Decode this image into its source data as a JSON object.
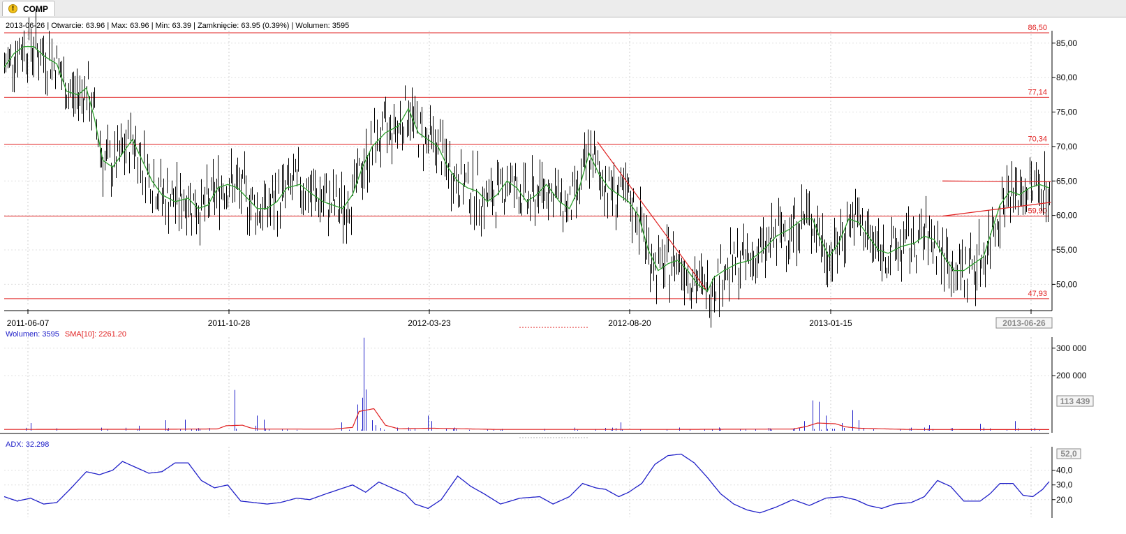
{
  "tab": {
    "label": "COMP",
    "icon": "warning-icon"
  },
  "info_bar": "2013-06-26 | Otwarcie: 63.96 | Max: 63.96 | Min: 63.39 | Zamknięcie: 63.95 (0.39%) | Wolumen: 3595",
  "colors": {
    "price_bars": "#000000",
    "ma_line": "#2ca02c",
    "levels": "#e02020",
    "volume_bars": "#2020c8",
    "sma": "#e02020",
    "adx": "#2020c8"
  },
  "chart_data": [
    {
      "type": "bar",
      "name": "price",
      "ylim": [
        47.0,
        86.8
      ],
      "yticks": [
        "85,00",
        "80,00",
        "75,00",
        "70,00",
        "65,00",
        "60,00",
        "55,00",
        "50,00"
      ],
      "ytick_values": [
        85,
        80,
        75,
        70,
        65,
        60,
        55,
        50
      ],
      "date_labels": [
        "2011-06-07",
        "2011-10-28",
        "2012-03-23",
        "2012-08-20",
        "2013-01-15"
      ],
      "last_date": "2013-06-26",
      "levels": [
        {
          "value": 86.5,
          "label": "86,50"
        },
        {
          "value": 77.14,
          "label": "77,14"
        },
        {
          "value": 70.34,
          "label": "70,34"
        },
        {
          "value": 59.9,
          "label": "59,90"
        },
        {
          "value": 47.93,
          "label": "47,93"
        }
      ],
      "ma_anchors": [
        [
          0,
          81.5
        ],
        [
          6,
          83.5
        ],
        [
          12,
          84.5
        ],
        [
          18,
          84.5
        ],
        [
          25,
          83
        ],
        [
          32,
          82
        ],
        [
          38,
          78
        ],
        [
          45,
          77.5
        ],
        [
          50,
          78.5
        ],
        [
          55,
          74
        ],
        [
          60,
          68
        ],
        [
          66,
          67
        ],
        [
          72,
          69
        ],
        [
          78,
          71
        ],
        [
          84,
          68
        ],
        [
          90,
          65
        ],
        [
          96,
          63
        ],
        [
          104,
          62
        ],
        [
          112,
          62.5
        ],
        [
          118,
          61
        ],
        [
          124,
          61.5
        ],
        [
          130,
          64
        ],
        [
          136,
          64.5
        ],
        [
          142,
          64
        ],
        [
          148,
          62.5
        ],
        [
          154,
          61
        ],
        [
          160,
          61
        ],
        [
          166,
          62
        ],
        [
          172,
          64
        ],
        [
          180,
          64.5
        ],
        [
          188,
          63
        ],
        [
          194,
          62
        ],
        [
          200,
          61.5
        ],
        [
          206,
          61
        ],
        [
          212,
          63
        ],
        [
          218,
          67
        ],
        [
          224,
          70
        ],
        [
          232,
          72
        ],
        [
          240,
          73
        ],
        [
          246,
          75.5
        ],
        [
          252,
          72
        ],
        [
          258,
          71
        ],
        [
          264,
          70
        ],
        [
          270,
          67
        ],
        [
          276,
          65
        ],
        [
          282,
          64
        ],
        [
          288,
          63.5
        ],
        [
          294,
          62
        ],
        [
          300,
          63
        ],
        [
          306,
          65
        ],
        [
          312,
          64
        ],
        [
          318,
          62
        ],
        [
          324,
          63
        ],
        [
          330,
          64.5
        ],
        [
          338,
          62
        ],
        [
          344,
          61
        ],
        [
          350,
          64
        ],
        [
          356,
          69
        ],
        [
          362,
          66
        ],
        [
          368,
          64
        ],
        [
          374,
          63
        ],
        [
          380,
          62
        ],
        [
          386,
          60
        ],
        [
          392,
          55
        ],
        [
          398,
          52
        ],
        [
          404,
          53
        ],
        [
          410,
          53.5
        ],
        [
          416,
          52
        ],
        [
          422,
          50
        ],
        [
          428,
          49
        ],
        [
          432,
          51
        ],
        [
          438,
          52
        ],
        [
          446,
          53
        ],
        [
          454,
          53.5
        ],
        [
          462,
          55
        ],
        [
          470,
          57
        ],
        [
          478,
          58
        ],
        [
          486,
          59.5
        ],
        [
          492,
          59.5
        ],
        [
          496,
          57
        ],
        [
          502,
          54
        ],
        [
          508,
          56
        ],
        [
          514,
          59.5
        ],
        [
          520,
          59
        ],
        [
          526,
          57
        ],
        [
          532,
          55
        ],
        [
          538,
          54.5
        ],
        [
          546,
          55.5
        ],
        [
          554,
          56
        ],
        [
          560,
          57
        ],
        [
          566,
          56.5
        ],
        [
          572,
          54
        ],
        [
          578,
          52
        ],
        [
          584,
          52
        ],
        [
          590,
          53
        ],
        [
          596,
          54
        ],
        [
          600,
          57
        ],
        [
          606,
          61.5
        ],
        [
          612,
          63.5
        ],
        [
          618,
          63
        ],
        [
          624,
          64
        ],
        [
          630,
          64.5
        ],
        [
          636,
          64
        ]
      ],
      "trend_lines": [
        {
          "from": [
            "2012-08-07",
            70.7
          ],
          "to": [
            "2012-12-06",
            49.3
          ]
        },
        {
          "from": [
            "2013-05-21",
            65.0
          ],
          "to": [
            "2013-06-26",
            64.9
          ]
        },
        {
          "from": [
            "2013-05-21",
            59.9
          ],
          "to": [
            "2013-06-26",
            61.9
          ]
        }
      ]
    },
    {
      "type": "bar",
      "name": "Wolumen",
      "legend_value": "Wolumen: 3595",
      "sma_legend": "SMA[10]: 2261.20",
      "yticks": [
        "300 000",
        "200 000"
      ],
      "ytick_values": [
        300000,
        200000
      ],
      "last_label": "113 439",
      "ylim": [
        0,
        340000
      ],
      "spikes": [
        [
          16,
          28000
        ],
        [
          82,
          18000
        ],
        [
          98,
          38000
        ],
        [
          110,
          40000
        ],
        [
          140,
          148000
        ],
        [
          153,
          18000
        ],
        [
          154,
          55000
        ],
        [
          158,
          40000
        ],
        [
          205,
          30000
        ],
        [
          215,
          95000
        ],
        [
          218,
          120000
        ],
        [
          219,
          338000
        ],
        [
          220,
          150000
        ],
        [
          224,
          38000
        ],
        [
          226,
          20000
        ],
        [
          258,
          55000
        ],
        [
          260,
          35000
        ],
        [
          375,
          30000
        ],
        [
          487,
          35000
        ],
        [
          492,
          110000
        ],
        [
          496,
          105000
        ],
        [
          500,
          55000
        ],
        [
          510,
          28000
        ],
        [
          516,
          75000
        ],
        [
          520,
          38000
        ],
        [
          563,
          20000
        ],
        [
          594,
          25000
        ],
        [
          615,
          35000
        ]
      ],
      "base_volume": 3000,
      "sma_anchors": [
        [
          0,
          4500
        ],
        [
          50,
          5000
        ],
        [
          100,
          5200
        ],
        [
          130,
          6500
        ],
        [
          135,
          18000
        ],
        [
          145,
          20000
        ],
        [
          150,
          10000
        ],
        [
          155,
          6000
        ],
        [
          200,
          5500
        ],
        [
          212,
          12000
        ],
        [
          216,
          70000
        ],
        [
          225,
          80000
        ],
        [
          232,
          20000
        ],
        [
          240,
          7000
        ],
        [
          260,
          9000
        ],
        [
          300,
          4500
        ],
        [
          400,
          4500
        ],
        [
          480,
          6000
        ],
        [
          488,
          15000
        ],
        [
          495,
          28000
        ],
        [
          506,
          25000
        ],
        [
          512,
          14000
        ],
        [
          520,
          9000
        ],
        [
          550,
          4500
        ],
        [
          600,
          4000
        ],
        [
          636,
          4000
        ]
      ]
    },
    {
      "type": "line",
      "name": "ADX",
      "legend_value": "ADX: 32.298",
      "yticks": [
        "40,0",
        "30,0",
        "20,0"
      ],
      "ytick_values": [
        40,
        30,
        20
      ],
      "last_label": "52,0",
      "ylim": [
        8,
        56
      ],
      "anchors": [
        [
          0,
          22
        ],
        [
          8,
          19
        ],
        [
          16,
          21
        ],
        [
          24,
          17
        ],
        [
          32,
          18
        ],
        [
          40,
          27
        ],
        [
          50,
          39
        ],
        [
          58,
          37
        ],
        [
          66,
          40
        ],
        [
          72,
          46
        ],
        [
          80,
          42
        ],
        [
          88,
          38
        ],
        [
          96,
          39
        ],
        [
          104,
          45
        ],
        [
          112,
          45
        ],
        [
          120,
          33
        ],
        [
          128,
          28
        ],
        [
          136,
          30
        ],
        [
          144,
          19
        ],
        [
          152,
          18
        ],
        [
          160,
          17
        ],
        [
          168,
          18
        ],
        [
          178,
          21
        ],
        [
          186,
          20
        ],
        [
          196,
          24
        ],
        [
          204,
          27
        ],
        [
          212,
          30
        ],
        [
          220,
          25
        ],
        [
          228,
          32
        ],
        [
          236,
          28
        ],
        [
          244,
          24
        ],
        [
          250,
          17
        ],
        [
          258,
          14
        ],
        [
          266,
          20
        ],
        [
          276,
          36
        ],
        [
          284,
          29
        ],
        [
          292,
          24
        ],
        [
          302,
          17
        ],
        [
          314,
          21
        ],
        [
          326,
          22
        ],
        [
          334,
          17
        ],
        [
          344,
          22
        ],
        [
          352,
          31
        ],
        [
          360,
          28
        ],
        [
          366,
          27
        ],
        [
          374,
          22
        ],
        [
          380,
          25
        ],
        [
          388,
          31
        ],
        [
          396,
          44
        ],
        [
          404,
          50
        ],
        [
          412,
          51
        ],
        [
          420,
          45
        ],
        [
          428,
          35
        ],
        [
          436,
          24
        ],
        [
          444,
          17
        ],
        [
          452,
          13
        ],
        [
          460,
          11
        ],
        [
          470,
          15
        ],
        [
          480,
          20
        ],
        [
          490,
          16
        ],
        [
          500,
          21
        ],
        [
          510,
          22
        ],
        [
          518,
          20
        ],
        [
          526,
          16
        ],
        [
          534,
          14
        ],
        [
          542,
          17
        ],
        [
          552,
          18
        ],
        [
          560,
          22
        ],
        [
          568,
          33
        ],
        [
          576,
          29
        ],
        [
          584,
          19
        ],
        [
          594,
          19
        ],
        [
          600,
          24
        ],
        [
          606,
          31
        ],
        [
          614,
          31
        ],
        [
          620,
          23
        ],
        [
          626,
          22
        ],
        [
          632,
          27
        ],
        [
          636,
          32.3
        ]
      ]
    }
  ]
}
